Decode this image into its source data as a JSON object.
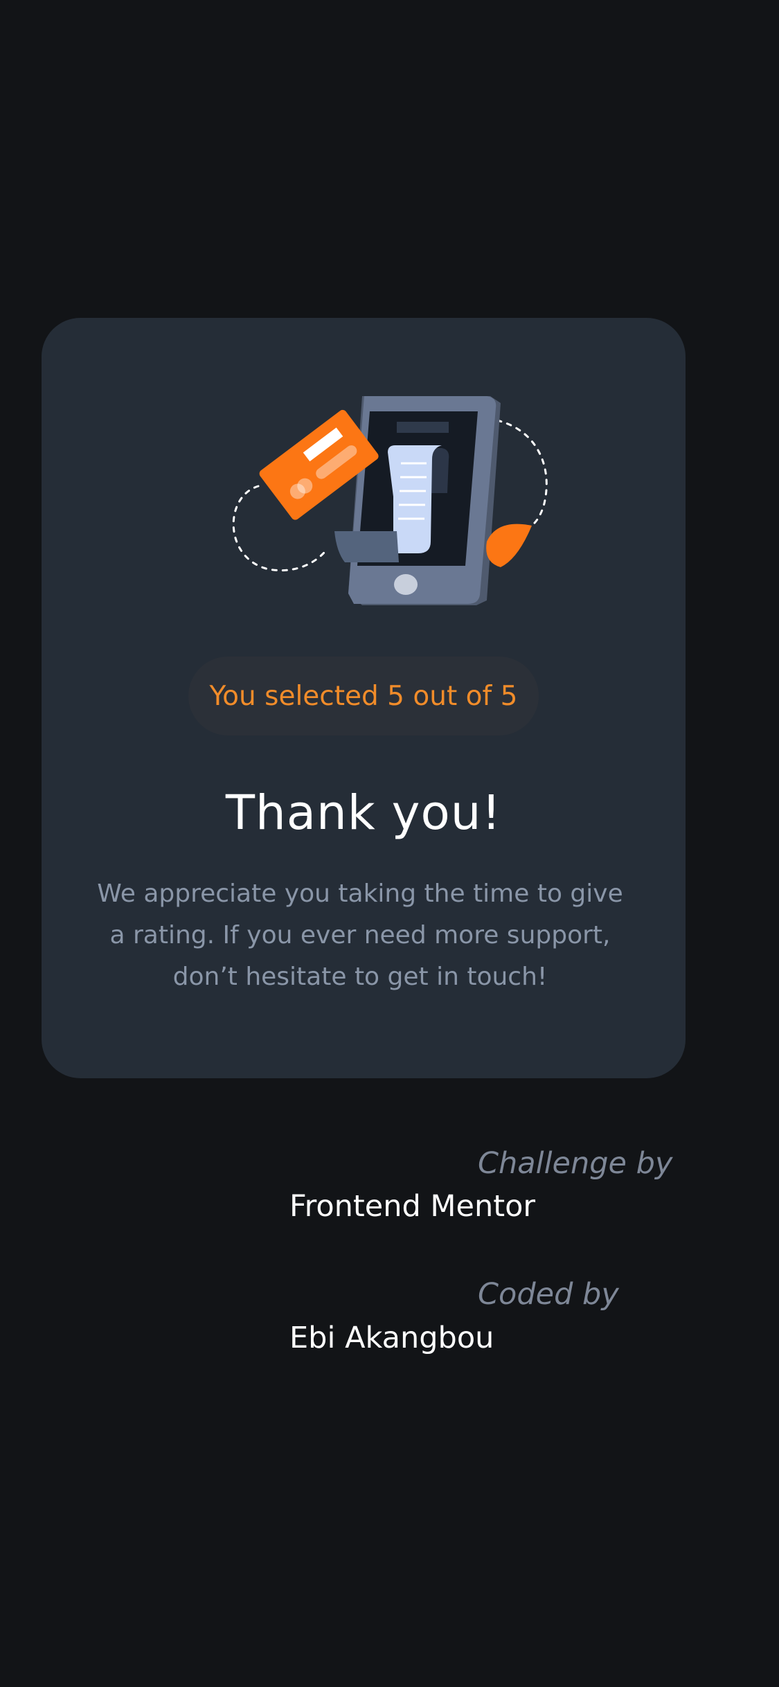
{
  "rating_card": {
    "selection_text": "You selected 5 out of 5",
    "title": "Thank you!",
    "description": "We appreciate you taking the time to give a rating. If you ever need more support, don’t hesitate to get in touch!",
    "illustration_icon": "phone-receipt-card-illustration"
  },
  "attribution": {
    "challenge_label": "Challenge by",
    "challenge_name": "Frontend Mentor",
    "coded_label": "Coded by",
    "coded_name": "Ebi Akangbou"
  },
  "colors": {
    "background": "#121417",
    "card": "#252d37",
    "accent_orange": "#fc7614",
    "selection_text": "#f18c2a",
    "muted_text": "#8a96a8"
  }
}
